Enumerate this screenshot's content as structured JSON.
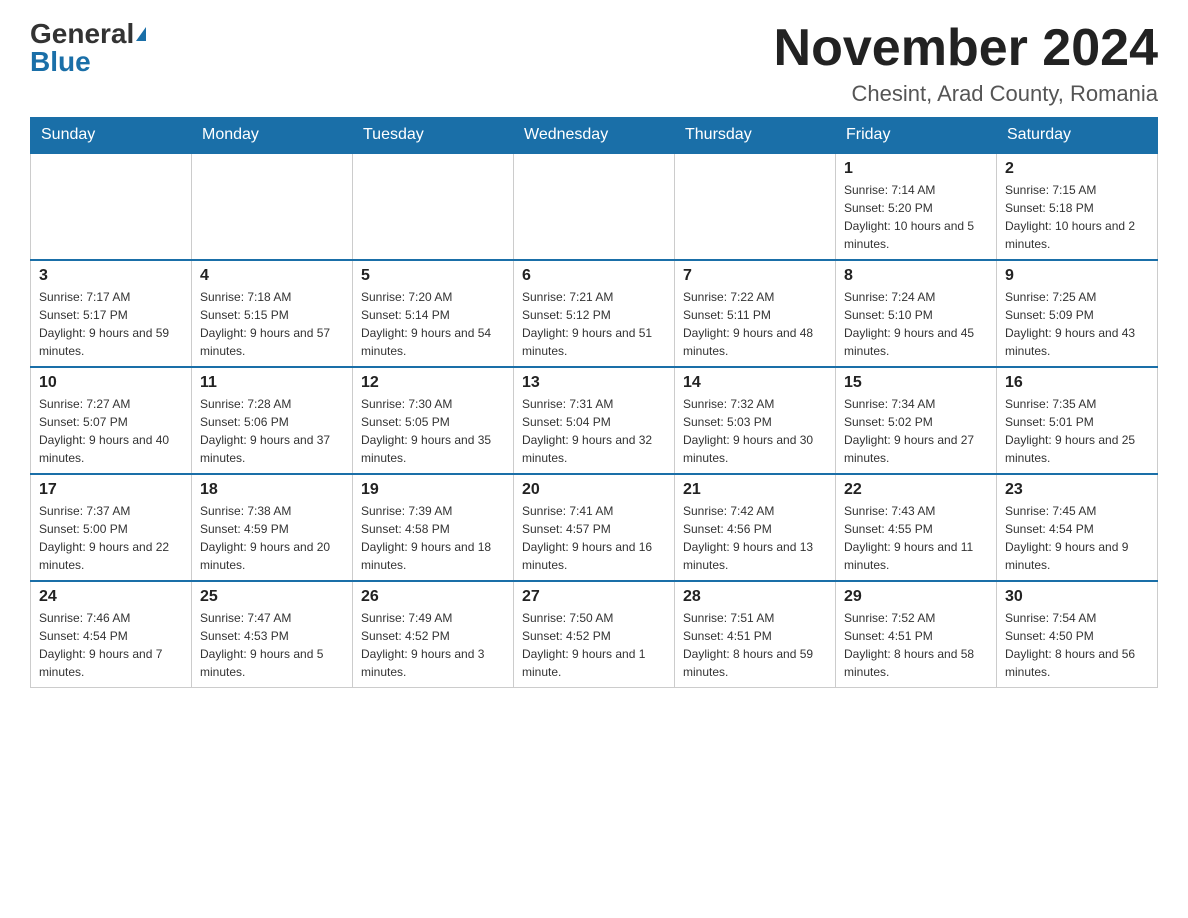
{
  "header": {
    "logo_general": "General",
    "logo_blue": "Blue",
    "month_title": "November 2024",
    "location": "Chesint, Arad County, Romania"
  },
  "days_of_week": [
    "Sunday",
    "Monday",
    "Tuesday",
    "Wednesday",
    "Thursday",
    "Friday",
    "Saturday"
  ],
  "weeks": [
    [
      {
        "day": "",
        "info": ""
      },
      {
        "day": "",
        "info": ""
      },
      {
        "day": "",
        "info": ""
      },
      {
        "day": "",
        "info": ""
      },
      {
        "day": "",
        "info": ""
      },
      {
        "day": "1",
        "info": "Sunrise: 7:14 AM\nSunset: 5:20 PM\nDaylight: 10 hours and 5 minutes."
      },
      {
        "day": "2",
        "info": "Sunrise: 7:15 AM\nSunset: 5:18 PM\nDaylight: 10 hours and 2 minutes."
      }
    ],
    [
      {
        "day": "3",
        "info": "Sunrise: 7:17 AM\nSunset: 5:17 PM\nDaylight: 9 hours and 59 minutes."
      },
      {
        "day": "4",
        "info": "Sunrise: 7:18 AM\nSunset: 5:15 PM\nDaylight: 9 hours and 57 minutes."
      },
      {
        "day": "5",
        "info": "Sunrise: 7:20 AM\nSunset: 5:14 PM\nDaylight: 9 hours and 54 minutes."
      },
      {
        "day": "6",
        "info": "Sunrise: 7:21 AM\nSunset: 5:12 PM\nDaylight: 9 hours and 51 minutes."
      },
      {
        "day": "7",
        "info": "Sunrise: 7:22 AM\nSunset: 5:11 PM\nDaylight: 9 hours and 48 minutes."
      },
      {
        "day": "8",
        "info": "Sunrise: 7:24 AM\nSunset: 5:10 PM\nDaylight: 9 hours and 45 minutes."
      },
      {
        "day": "9",
        "info": "Sunrise: 7:25 AM\nSunset: 5:09 PM\nDaylight: 9 hours and 43 minutes."
      }
    ],
    [
      {
        "day": "10",
        "info": "Sunrise: 7:27 AM\nSunset: 5:07 PM\nDaylight: 9 hours and 40 minutes."
      },
      {
        "day": "11",
        "info": "Sunrise: 7:28 AM\nSunset: 5:06 PM\nDaylight: 9 hours and 37 minutes."
      },
      {
        "day": "12",
        "info": "Sunrise: 7:30 AM\nSunset: 5:05 PM\nDaylight: 9 hours and 35 minutes."
      },
      {
        "day": "13",
        "info": "Sunrise: 7:31 AM\nSunset: 5:04 PM\nDaylight: 9 hours and 32 minutes."
      },
      {
        "day": "14",
        "info": "Sunrise: 7:32 AM\nSunset: 5:03 PM\nDaylight: 9 hours and 30 minutes."
      },
      {
        "day": "15",
        "info": "Sunrise: 7:34 AM\nSunset: 5:02 PM\nDaylight: 9 hours and 27 minutes."
      },
      {
        "day": "16",
        "info": "Sunrise: 7:35 AM\nSunset: 5:01 PM\nDaylight: 9 hours and 25 minutes."
      }
    ],
    [
      {
        "day": "17",
        "info": "Sunrise: 7:37 AM\nSunset: 5:00 PM\nDaylight: 9 hours and 22 minutes."
      },
      {
        "day": "18",
        "info": "Sunrise: 7:38 AM\nSunset: 4:59 PM\nDaylight: 9 hours and 20 minutes."
      },
      {
        "day": "19",
        "info": "Sunrise: 7:39 AM\nSunset: 4:58 PM\nDaylight: 9 hours and 18 minutes."
      },
      {
        "day": "20",
        "info": "Sunrise: 7:41 AM\nSunset: 4:57 PM\nDaylight: 9 hours and 16 minutes."
      },
      {
        "day": "21",
        "info": "Sunrise: 7:42 AM\nSunset: 4:56 PM\nDaylight: 9 hours and 13 minutes."
      },
      {
        "day": "22",
        "info": "Sunrise: 7:43 AM\nSunset: 4:55 PM\nDaylight: 9 hours and 11 minutes."
      },
      {
        "day": "23",
        "info": "Sunrise: 7:45 AM\nSunset: 4:54 PM\nDaylight: 9 hours and 9 minutes."
      }
    ],
    [
      {
        "day": "24",
        "info": "Sunrise: 7:46 AM\nSunset: 4:54 PM\nDaylight: 9 hours and 7 minutes."
      },
      {
        "day": "25",
        "info": "Sunrise: 7:47 AM\nSunset: 4:53 PM\nDaylight: 9 hours and 5 minutes."
      },
      {
        "day": "26",
        "info": "Sunrise: 7:49 AM\nSunset: 4:52 PM\nDaylight: 9 hours and 3 minutes."
      },
      {
        "day": "27",
        "info": "Sunrise: 7:50 AM\nSunset: 4:52 PM\nDaylight: 9 hours and 1 minute."
      },
      {
        "day": "28",
        "info": "Sunrise: 7:51 AM\nSunset: 4:51 PM\nDaylight: 8 hours and 59 minutes."
      },
      {
        "day": "29",
        "info": "Sunrise: 7:52 AM\nSunset: 4:51 PM\nDaylight: 8 hours and 58 minutes."
      },
      {
        "day": "30",
        "info": "Sunrise: 7:54 AM\nSunset: 4:50 PM\nDaylight: 8 hours and 56 minutes."
      }
    ]
  ]
}
